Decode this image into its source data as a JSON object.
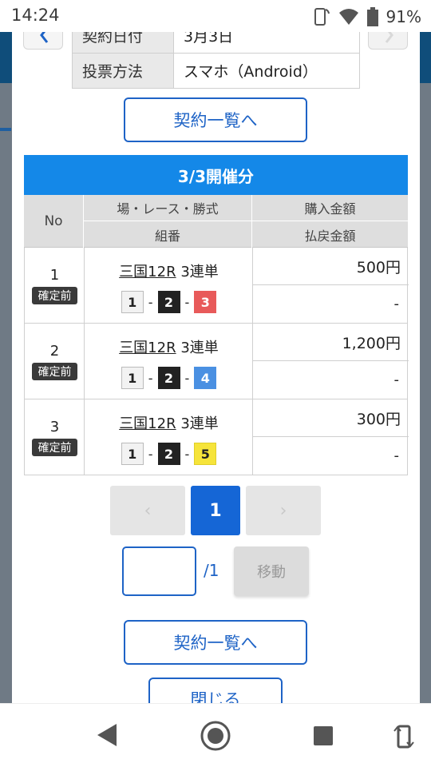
{
  "status_bar": {
    "time": "14:24",
    "battery": "91%"
  },
  "modal": {
    "info": {
      "row1_label": "契約日付",
      "row1_value": "3月3日",
      "row2_label": "投票方法",
      "row2_value": "スマホ（Android）"
    },
    "contract_list_button": "契約一覧へ",
    "section_title": "3/3開催分",
    "table_headers": {
      "no": "No",
      "race": "場・レース・勝式",
      "combo": "組番",
      "amount": "購入金額",
      "payout": "払戻金額"
    },
    "rows": [
      {
        "no": "1",
        "status": "確定前",
        "race": "三国12R",
        "bet_type": "3連単",
        "n1": "1",
        "n2": "2",
        "n3": "3",
        "amount": "500円",
        "payout": "-"
      },
      {
        "no": "2",
        "status": "確定前",
        "race": "三国12R",
        "bet_type": "3連単",
        "n1": "1",
        "n2": "2",
        "n3": "4",
        "amount": "1,200円",
        "payout": "-"
      },
      {
        "no": "3",
        "status": "確定前",
        "race": "三国12R",
        "bet_type": "3連単",
        "n1": "1",
        "n2": "2",
        "n3": "5",
        "amount": "300円",
        "payout": "-"
      }
    ],
    "pagination": {
      "prev": "‹",
      "current": "1",
      "next": "›",
      "total": "/1",
      "move_label": "移動",
      "page_input_value": ""
    },
    "contract_list_button_bottom": "契約一覧へ",
    "close_button": "閉じる",
    "colors": {
      "accent": "#1566d6",
      "header_bar": "#1488e8",
      "boat1": "#f2f2f2",
      "boat2": "#222222",
      "boat3": "#e85a5a",
      "boat4": "#4a90e2",
      "boat5": "#f6e43a"
    }
  },
  "icons": {
    "signal": "phone-signal-icon",
    "wifi": "wifi-icon",
    "battery": "battery-icon",
    "back": "back-triangle-icon",
    "home": "home-circle-icon",
    "recents": "recents-square-icon",
    "rotate": "rotate-icon"
  }
}
